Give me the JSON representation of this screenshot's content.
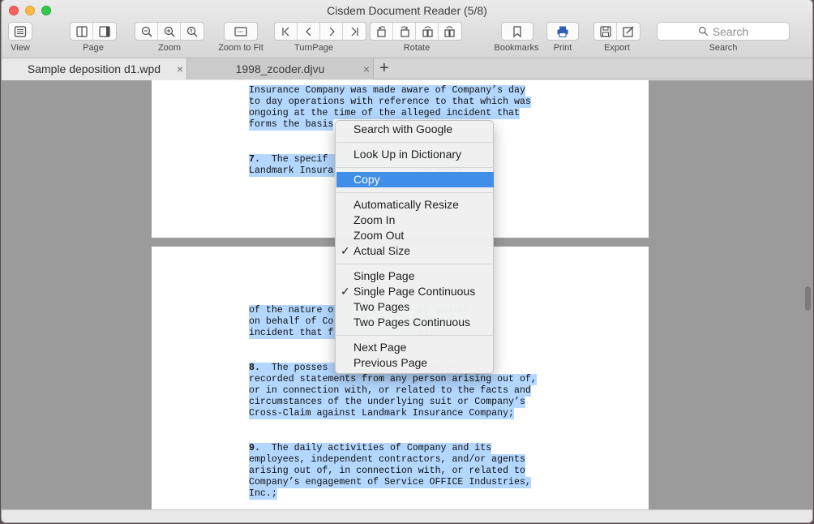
{
  "window": {
    "title": "Cisdem Document Reader (5/8)"
  },
  "toolbar": {
    "view_label": "View",
    "page_label": "Page",
    "zoom_label": "Zoom",
    "zoom_fit_label": "Zoom to Fit",
    "turnpage_label": "TurnPage",
    "rotate_label": "Rotate",
    "bookmarks_label": "Bookmarks",
    "print_label": "Print",
    "export_label": "Export",
    "search_label": "Search",
    "search_placeholder": "Search"
  },
  "tabs": [
    {
      "label": "Sample deposition d1.wpd",
      "active": true
    },
    {
      "label": "1998_zcoder.djvu",
      "active": false
    }
  ],
  "tab_add_symbol": "+",
  "tab_close_symbol": "×",
  "document": {
    "page1_lines": [
      "Insurance Company was made aware of Company’s day",
      "to day operations with reference to that which was",
      "ongoing at the time of the alleged incident that",
      "forms the basis"
    ],
    "page1_item7_number": "7.",
    "page1_item7_lines": [
      "  The specif                  s that",
      "Landmark Insura               ly aware"
    ],
    "page2_lines_a": [
      "of the nature o               by and/or",
      "on behalf of Co               lleged",
      "incident that f               uit;"
    ],
    "page2_item8_number": "8.",
    "page2_item8_lines": [
      "  The posses                  en or",
      "recorded statements from any person arising out of,",
      "or in connection with, or related to the facts and",
      "circumstances of the underlying suit or Company’s",
      "Cross-Claim against Landmark Insurance Company;"
    ],
    "page2_item9_number": "9.",
    "page2_item9_lines": [
      "  The daily activities of Company and its",
      "employees, independent contractors, and/or agents",
      "arising out of, in connection with, or related to",
      "Company’s engagement of Service OFFICE Industries,",
      "Inc.;"
    ]
  },
  "context_menu": {
    "check_symbol": "✓",
    "items": [
      {
        "label": "Search with Google"
      },
      {
        "label": "Look Up in Dictionary"
      },
      {
        "label": "Copy",
        "highlighted": true
      },
      {
        "label": "Automatically Resize"
      },
      {
        "label": "Zoom In"
      },
      {
        "label": "Zoom Out"
      },
      {
        "label": "Actual Size",
        "checked": true
      },
      {
        "label": "Single Page"
      },
      {
        "label": "Single Page Continuous",
        "checked": true
      },
      {
        "label": "Two Pages"
      },
      {
        "label": "Two Pages Continuous"
      },
      {
        "label": "Next Page"
      },
      {
        "label": "Previous Page"
      }
    ]
  },
  "colors": {
    "selection": "#b3d7fe",
    "menu_highlight": "#3f8ee8",
    "page_background": "#9b9b9b"
  }
}
